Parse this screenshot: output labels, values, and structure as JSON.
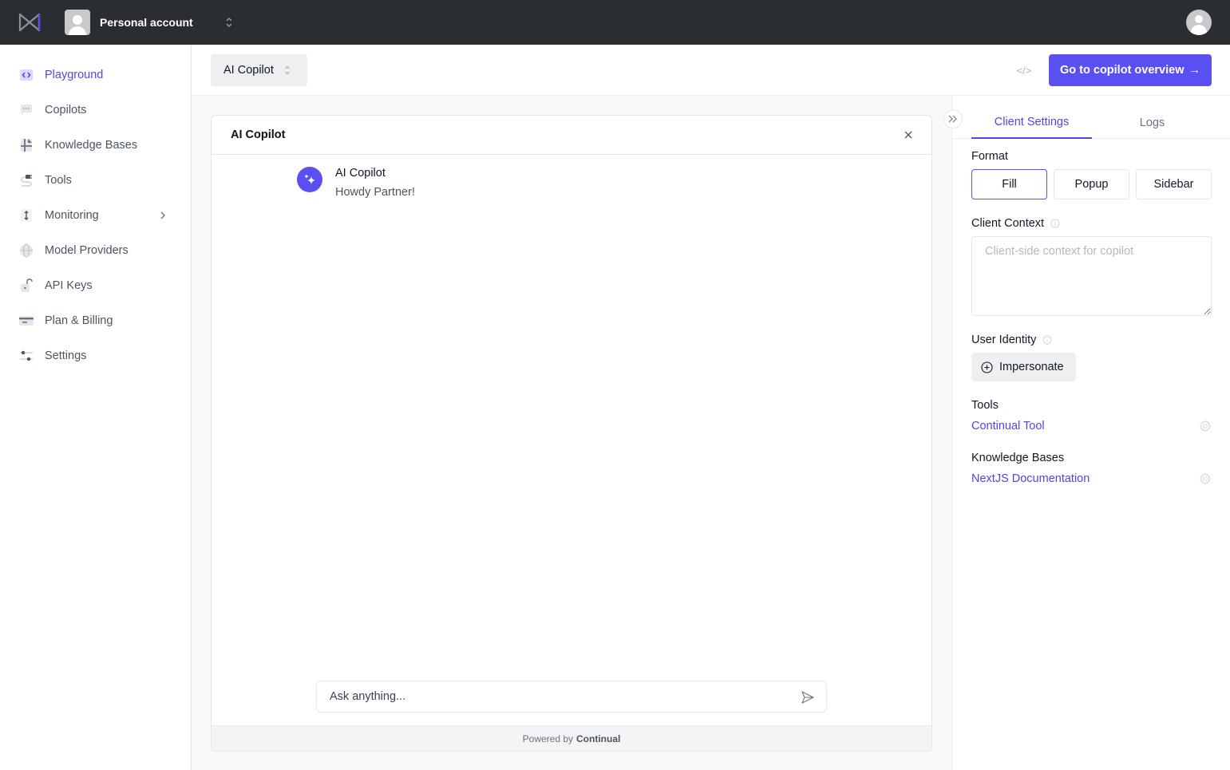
{
  "topbar": {
    "account_name": "Personal account"
  },
  "sidebar": {
    "items": [
      {
        "label": "Playground",
        "icon": "code-brackets-icon",
        "active": true
      },
      {
        "label": "Copilots",
        "icon": "chat-bubble-icon"
      },
      {
        "label": "Knowledge Bases",
        "icon": "book-icon"
      },
      {
        "label": "Tools",
        "icon": "plug-icon"
      },
      {
        "label": "Monitoring",
        "icon": "up-down-arrows-icon",
        "has_submenu": true
      },
      {
        "label": "Model Providers",
        "icon": "globe-icon"
      },
      {
        "label": "API Keys",
        "icon": "lock-icon"
      },
      {
        "label": "Plan & Billing",
        "icon": "credit-card-icon"
      },
      {
        "label": "Settings",
        "icon": "sliders-icon"
      }
    ]
  },
  "header": {
    "copilot_select": "AI Copilot",
    "code_label": "</>",
    "overview_button": "Go to copilot overview",
    "overview_arrow": "→"
  },
  "chat": {
    "title": "AI Copilot",
    "messages": [
      {
        "author": "AI Copilot",
        "text": "Howdy Partner!"
      }
    ],
    "input_placeholder": "Ask anything...",
    "footer_prefix": "Powered by",
    "footer_brand": "Continual"
  },
  "right_panel": {
    "tabs": [
      {
        "label": "Client Settings",
        "active": true
      },
      {
        "label": "Logs",
        "active": false
      }
    ],
    "format": {
      "label": "Format",
      "options": [
        "Fill",
        "Popup",
        "Sidebar"
      ],
      "selected": "Fill"
    },
    "client_context": {
      "label": "Client Context",
      "placeholder": "Client-side context for copilot",
      "value": ""
    },
    "user_identity": {
      "label": "User Identity",
      "button": "Impersonate"
    },
    "tools": {
      "label": "Tools",
      "items": [
        "Continual Tool"
      ]
    },
    "knowledge_bases": {
      "label": "Knowledge Bases",
      "items": [
        "NextJS Documentation"
      ]
    }
  },
  "colors": {
    "accent": "#5a4ff0",
    "topbar_bg": "#2a2d31"
  }
}
